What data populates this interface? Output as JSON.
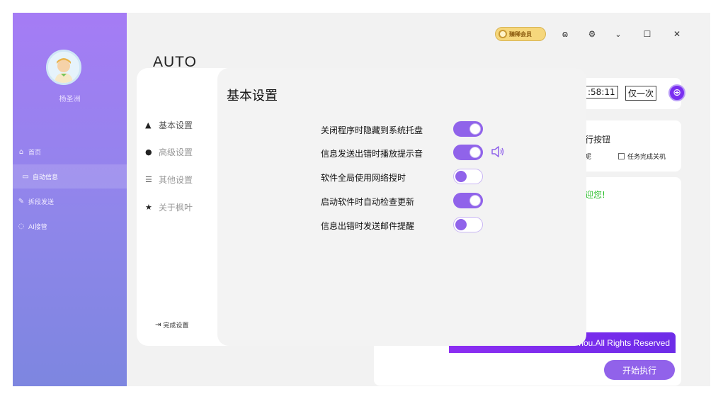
{
  "sidebar": {
    "username": "杨圣洲",
    "items": [
      {
        "label": "首页",
        "icon": "home-icon"
      },
      {
        "label": "自动信息",
        "icon": "message-icon"
      },
      {
        "label": "拆段发送",
        "icon": "pen-icon"
      },
      {
        "label": "AI接管",
        "icon": "robot-icon"
      }
    ]
  },
  "header": {
    "vip_label": "臻稀会员",
    "app_title": "AUTO"
  },
  "background": {
    "time_value": ":58:11",
    "frequency": "仅一次",
    "execute_button_title": "行按钮",
    "checkbox_partial": "呢",
    "checkbox_shutdown": "任务完成关机",
    "welcome_text": "迎您!",
    "footer_text": "nou.All Rights Reserved",
    "start_button": "开始执行"
  },
  "settings": {
    "nav": [
      {
        "label": "基本设置",
        "icon": "home-icon"
      },
      {
        "label": "高级设置",
        "icon": "dot-icon"
      },
      {
        "label": "其他设置",
        "icon": "list-icon"
      },
      {
        "label": "关于枫叶",
        "icon": "star-icon"
      }
    ],
    "done_label": "完成设置",
    "panel_title": "基本设置",
    "options": [
      {
        "label": "关闭程序时隐藏到系统托盘",
        "enabled": true
      },
      {
        "label": "信息发送出错时播放提示音",
        "enabled": true
      },
      {
        "label": "软件全局使用网络授时",
        "enabled": false
      },
      {
        "label": "启动软件时自动检查更新",
        "enabled": true
      },
      {
        "label": "信息出错时发送邮件提醒",
        "enabled": false
      }
    ]
  },
  "colors": {
    "accent": "#9063ea",
    "sidebar_top": "#a57cf5",
    "sidebar_bottom": "#7d86e0",
    "welcome_green": "#2bbf2b"
  }
}
